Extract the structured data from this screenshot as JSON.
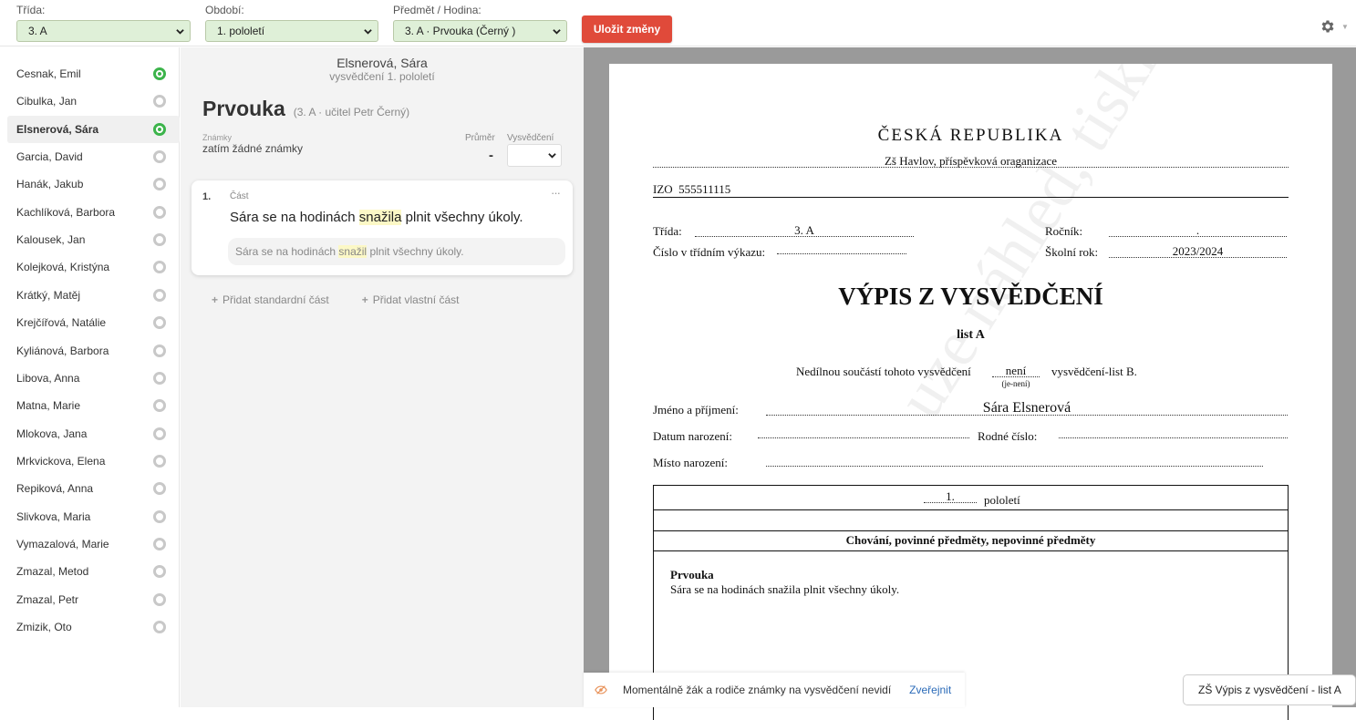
{
  "topbar": {
    "class": {
      "label": "Třída:",
      "value": "3. A"
    },
    "period": {
      "label": "Období:",
      "value": "1. pololetí"
    },
    "subject": {
      "label": "Předmět / Hodina:",
      "value": "3. A · Prvouka (Černý )"
    },
    "save_label": "Uložit změny"
  },
  "students": [
    {
      "name": "Cesnak, Emil",
      "status": "done"
    },
    {
      "name": "Cibulka, Jan",
      "status": "empty"
    },
    {
      "name": "Elsnerová, Sára",
      "status": "done",
      "active": true
    },
    {
      "name": "Garcia, David",
      "status": "empty"
    },
    {
      "name": "Hanák, Jakub",
      "status": "empty"
    },
    {
      "name": "Kachlíková, Barbora",
      "status": "empty"
    },
    {
      "name": "Kalousek, Jan",
      "status": "empty"
    },
    {
      "name": "Kolejková, Kristýna",
      "status": "empty"
    },
    {
      "name": "Krátký, Matěj",
      "status": "empty"
    },
    {
      "name": "Krejčířová, Natálie",
      "status": "empty"
    },
    {
      "name": "Kyliánová, Barbora",
      "status": "empty"
    },
    {
      "name": "Libova, Anna",
      "status": "empty"
    },
    {
      "name": "Matna, Marie",
      "status": "empty"
    },
    {
      "name": "Mlokova, Jana",
      "status": "empty"
    },
    {
      "name": "Mrkvickova, Elena",
      "status": "empty"
    },
    {
      "name": "Repiková, Anna",
      "status": "empty"
    },
    {
      "name": "Slivkova, Maria",
      "status": "empty"
    },
    {
      "name": "Vymazalová, Marie",
      "status": "empty"
    },
    {
      "name": "Zmazal, Metod",
      "status": "empty"
    },
    {
      "name": "Zmazal, Petr",
      "status": "empty"
    },
    {
      "name": "Zmizik, Oto",
      "status": "empty"
    }
  ],
  "detail": {
    "student_name": "Elsnerová, Sára",
    "report_period": "vysvědčení 1. pololetí",
    "subject_title": "Prvouka",
    "subject_meta": "(3. A · učitel Petr Černý)",
    "grades_label": "Známky",
    "grades_value": "zatím žádné známky",
    "average_label": "Průměr",
    "average_value": "-",
    "report_label": "Vysvědčení",
    "card": {
      "number": "1.",
      "part_label": "Část",
      "more": "···",
      "text_before": "Sára se na hodinách ",
      "text_mark": "snažila",
      "text_after": " plnit všechny úkoly.",
      "suggest_before": "Sára se na hodinách ",
      "suggest_mark": "snažil",
      "suggest_after": " plnit všechny úkoly."
    },
    "add_standard": "Přidat standardní část",
    "add_custom": "Přidat vlastní část"
  },
  "document": {
    "country": "ČESKÁ REPUBLIKA",
    "school": "Zš Havlov, příspěvková oraganizace",
    "izo_label": "IZO",
    "izo_value": "555511115",
    "class_label": "Třída:",
    "class_value": "3. A",
    "year_label": "Ročník:",
    "year_value": ".",
    "register_label": "Číslo v třídním výkazu:",
    "school_year_label": "Školní rok:",
    "school_year_value": "2023/2024",
    "title": "VÝPIS Z VYSVĚDČENÍ",
    "sheet": "list A",
    "integral_before": "Nedílnou součástí tohoto vysvědčení",
    "integral_value": "není",
    "integral_hint": "(je-není)",
    "integral_after": "vysvědčení-list B.",
    "name_label": "Jméno a příjmení:",
    "name_value": "Sára Elsnerová",
    "birth_label": "Datum narození:",
    "birth_number_label": "Rodné číslo:",
    "birth_place_label": "Místo narození:",
    "term_number": "1.",
    "term_label": "pololetí",
    "section_header": "Chování, povinné předměty, nepovinné předměty",
    "subject_name": "Prvouka",
    "subject_text": "Sára se na hodinách snažila plnit všechny úkoly.",
    "watermark": "uze náhled, tisknout"
  },
  "notice": {
    "text": "Momentálně žák a rodiče známky na vysvědčení nevidí",
    "link": "Zveřejnit"
  },
  "report_select": "ZŠ Výpis z vysvědčení - list A"
}
